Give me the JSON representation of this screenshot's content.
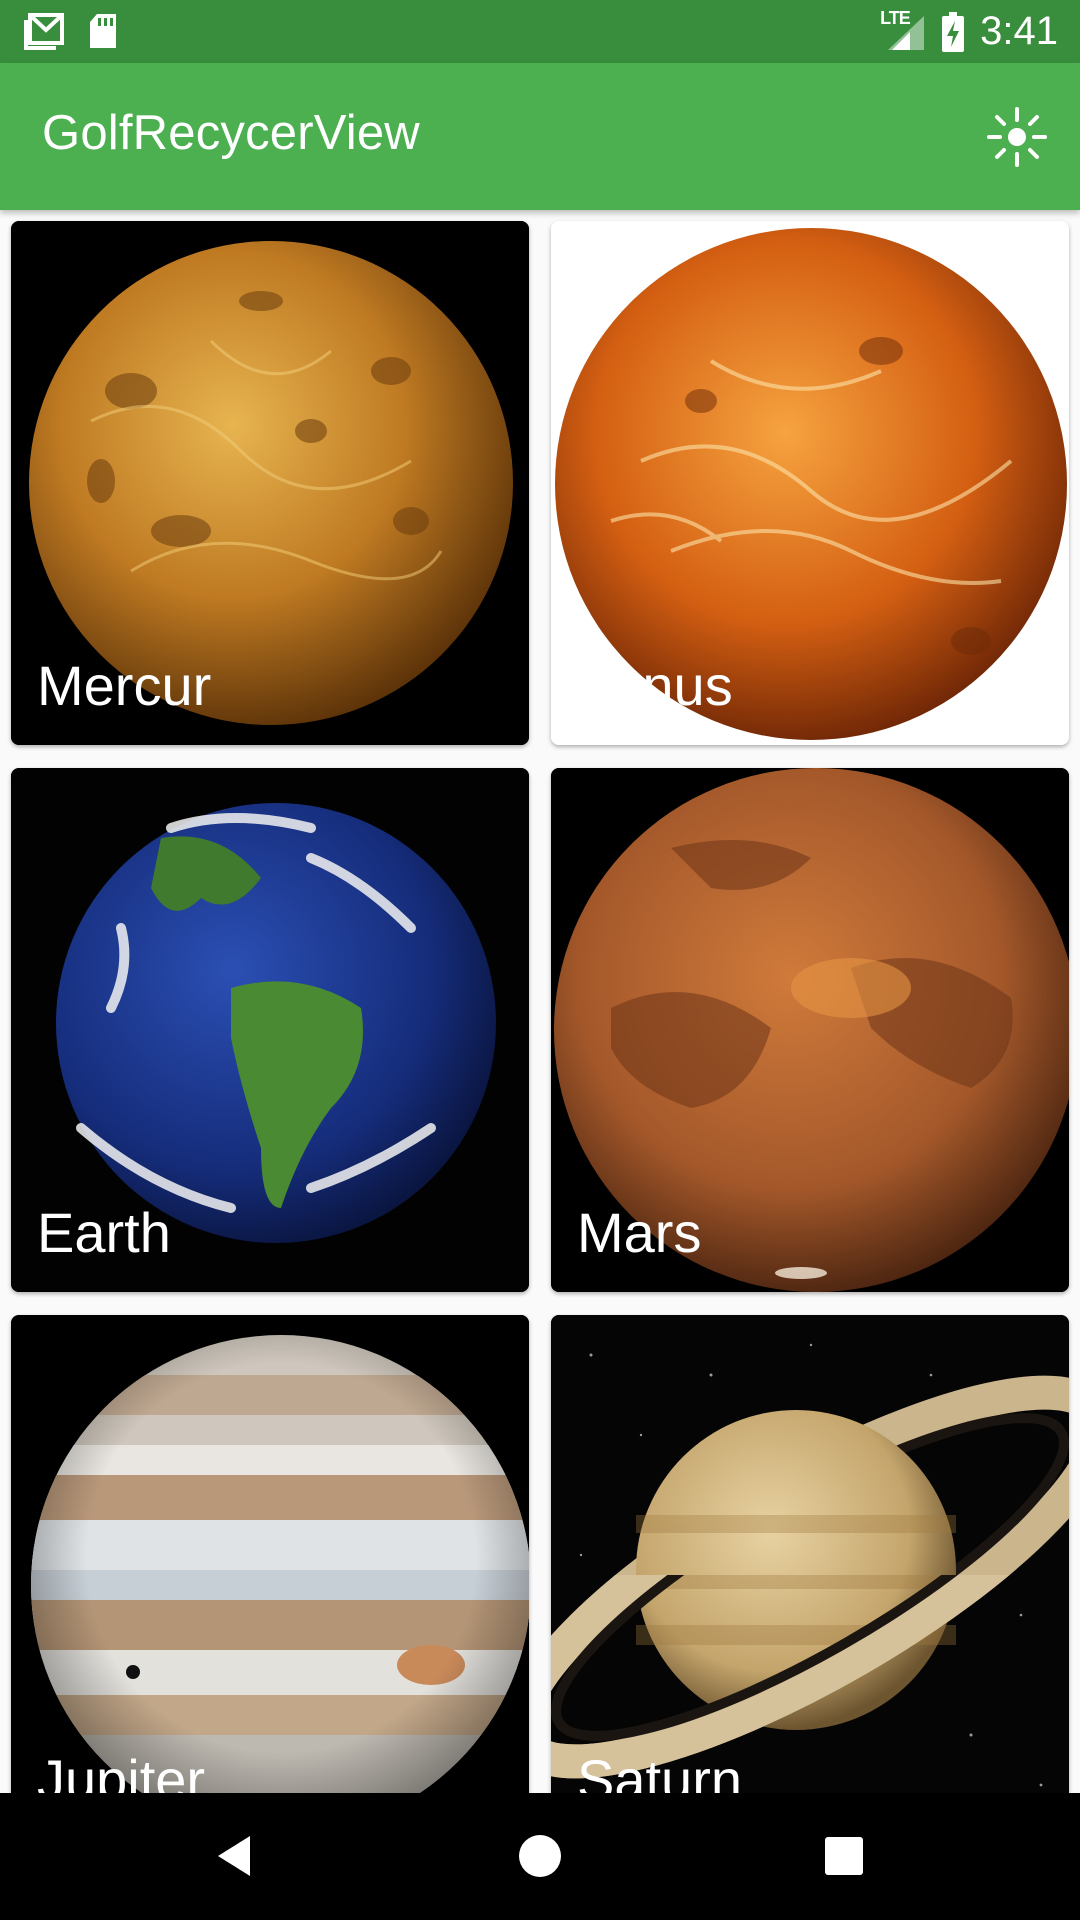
{
  "status_bar": {
    "time": "3:41",
    "network": "LTE",
    "left_icons": [
      "gmail-icon",
      "sd-card-icon"
    ],
    "right_icons": [
      "signal-icon",
      "battery-charging-icon"
    ]
  },
  "app_bar": {
    "title": "GolfRecycerView",
    "action_icon": "brightness-icon",
    "background": "#4caf50"
  },
  "planets": [
    {
      "name": "Mercur"
    },
    {
      "name": "Venus"
    },
    {
      "name": "Earth"
    },
    {
      "name": "Mars"
    },
    {
      "name": "Jupiter"
    },
    {
      "name": "Saturn"
    }
  ],
  "nav_bar": {
    "buttons": [
      "back-icon",
      "home-icon",
      "recents-icon"
    ]
  },
  "colors": {
    "status_bar": "#388e3c",
    "app_bar": "#4caf50"
  }
}
